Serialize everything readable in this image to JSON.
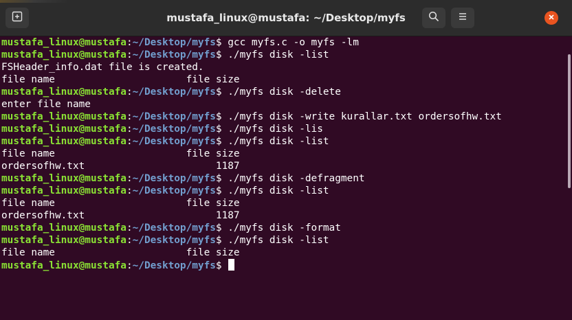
{
  "window": {
    "title": "mustafa_linux@mustafa: ~/Desktop/myfs",
    "accent_close": "#e95420",
    "prompt_user_color": "#8ae234",
    "prompt_path_color": "#729fcf",
    "background": "#300a24"
  },
  "toolbar": {
    "new_tab_icon": "new-tab-icon",
    "search_icon": "search-icon",
    "menu_icon": "hamburger-menu-icon",
    "close_icon": "close-icon"
  },
  "terminal": {
    "lines": [
      {
        "type": "prompt",
        "user": "mustafa_linux@mustafa",
        "path": "~/Desktop/myfs",
        "cmd": "gcc myfs.c -o myfs -lm"
      },
      {
        "type": "prompt",
        "user": "mustafa_linux@mustafa",
        "path": "~/Desktop/myfs",
        "cmd": "./myfs disk -list"
      },
      {
        "type": "output",
        "text": "FSHeader_info.dat file is created."
      },
      {
        "type": "output",
        "text": "file name                      file size"
      },
      {
        "type": "prompt",
        "user": "mustafa_linux@mustafa",
        "path": "~/Desktop/myfs",
        "cmd": "./myfs disk -delete"
      },
      {
        "type": "output",
        "text": "enter file name"
      },
      {
        "type": "prompt",
        "user": "mustafa_linux@mustafa",
        "path": "~/Desktop/myfs",
        "cmd": "./myfs disk -write kurallar.txt ordersofhw.txt"
      },
      {
        "type": "prompt",
        "user": "mustafa_linux@mustafa",
        "path": "~/Desktop/myfs",
        "cmd": "./myfs disk -lis"
      },
      {
        "type": "prompt",
        "user": "mustafa_linux@mustafa",
        "path": "~/Desktop/myfs",
        "cmd": "./myfs disk -list"
      },
      {
        "type": "output",
        "text": "file name                      file size"
      },
      {
        "type": "output",
        "text": "ordersofhw.txt                      1187"
      },
      {
        "type": "prompt",
        "user": "mustafa_linux@mustafa",
        "path": "~/Desktop/myfs",
        "cmd": "./myfs disk -defragment"
      },
      {
        "type": "prompt",
        "user": "mustafa_linux@mustafa",
        "path": "~/Desktop/myfs",
        "cmd": "./myfs disk -list"
      },
      {
        "type": "output",
        "text": "file name                      file size"
      },
      {
        "type": "output",
        "text": "ordersofhw.txt                      1187"
      },
      {
        "type": "prompt",
        "user": "mustafa_linux@mustafa",
        "path": "~/Desktop/myfs",
        "cmd": "./myfs disk -format"
      },
      {
        "type": "prompt",
        "user": "mustafa_linux@mustafa",
        "path": "~/Desktop/myfs",
        "cmd": "./myfs disk -list"
      },
      {
        "type": "output",
        "text": "file name                      file size"
      },
      {
        "type": "prompt",
        "user": "mustafa_linux@mustafa",
        "path": "~/Desktop/myfs",
        "cmd": "",
        "cursor": true
      }
    ]
  }
}
